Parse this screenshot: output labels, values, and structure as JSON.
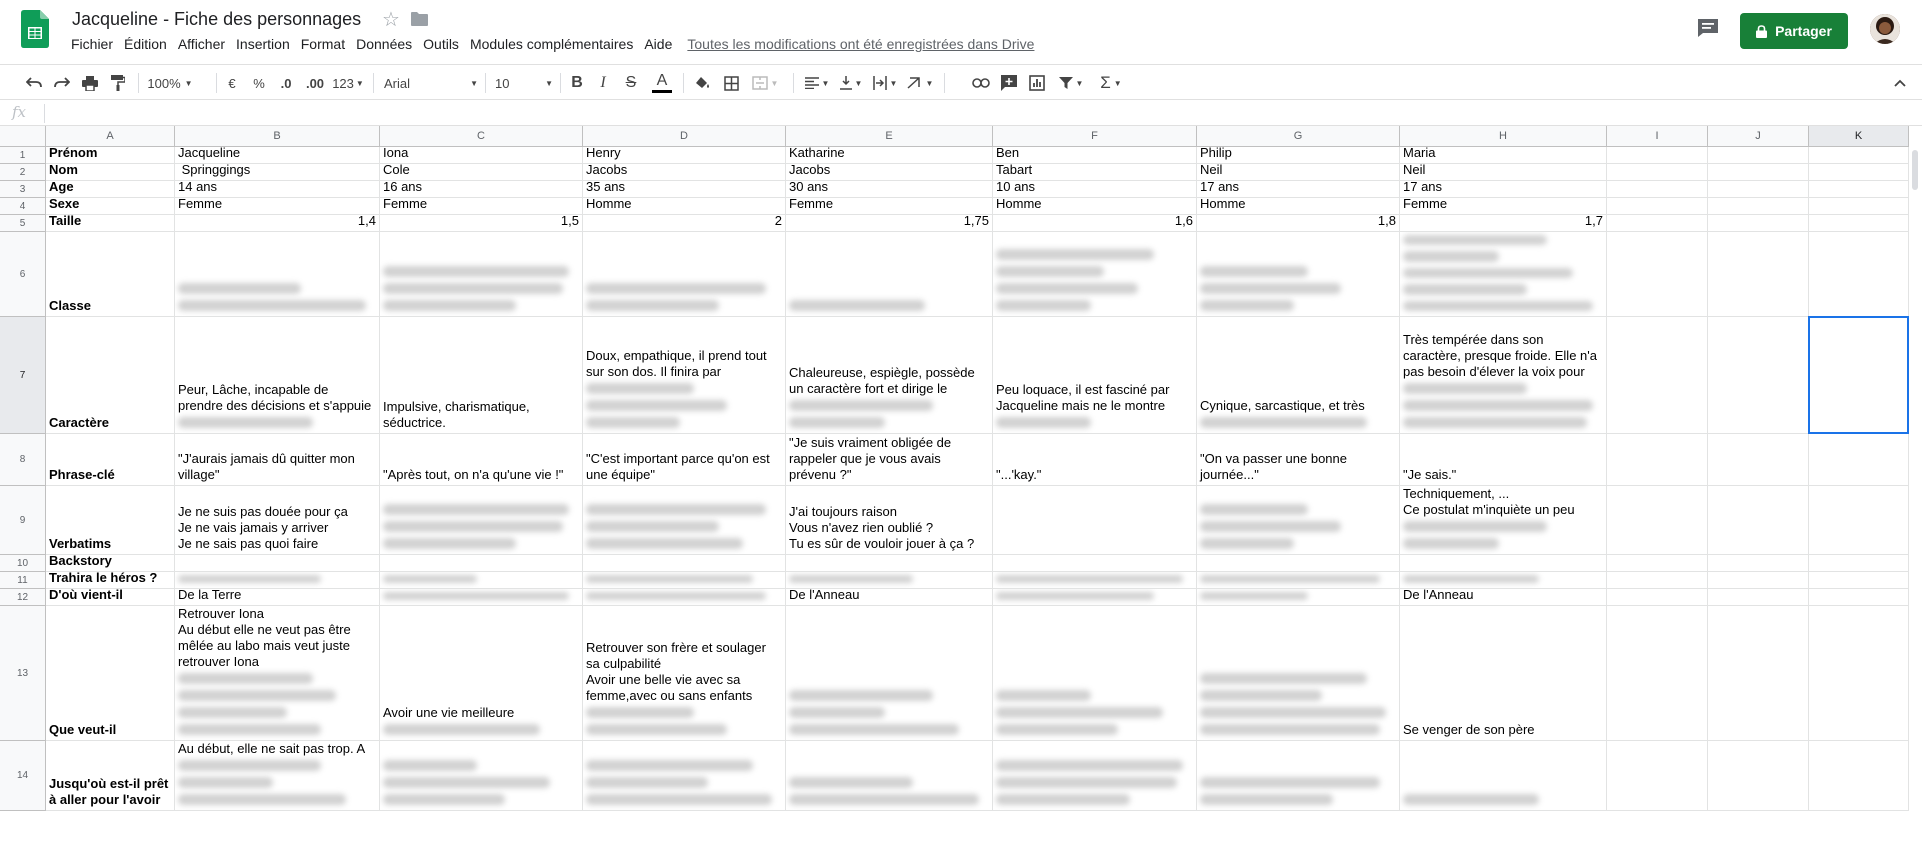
{
  "app": {
    "title": "Jacqueline - Fiche des personnages",
    "saved_status": "Toutes les modifications ont été enregistrées dans Drive",
    "share_label": "Partager",
    "accent_color": "#188038",
    "menu": [
      "Fichier",
      "Édition",
      "Afficher",
      "Insertion",
      "Format",
      "Données",
      "Outils",
      "Modules complémentaires",
      "Aide"
    ]
  },
  "toolbar": {
    "zoom": "100%",
    "currency": "€",
    "percent": "%",
    "dec_less": ".0",
    "dec_more": ".00",
    "format_more": "123",
    "font": "Arial",
    "size": "10",
    "bold": "B",
    "italic": "I",
    "strike": "S",
    "textcolor": "A",
    "icons": [
      "undo-icon",
      "redo-icon",
      "print-icon",
      "paint-format-icon",
      "fill-color-icon",
      "borders-icon",
      "merge-icon",
      "align-left-icon",
      "valign-icon",
      "wrap-icon",
      "rotate-icon",
      "link-icon",
      "comment-icon",
      "chart-icon",
      "filter-icon",
      "functions-icon",
      "collapse-icon"
    ]
  },
  "formula_bar": {
    "fx": "fx",
    "value": ""
  },
  "sheet": {
    "columns": [
      "A",
      "B",
      "C",
      "D",
      "E",
      "F",
      "G",
      "H",
      "I",
      "J",
      "K"
    ],
    "rows": [
      {
        "n": "1",
        "cells": [
          {
            "t": "Prénom",
            "b": 1
          },
          {
            "t": "Jacqueline"
          },
          {
            "t": "Iona"
          },
          {
            "t": "Henry"
          },
          {
            "t": "Katharine"
          },
          {
            "t": "Ben"
          },
          {
            "t": "Philip"
          },
          {
            "t": "Maria"
          }
        ]
      },
      {
        "n": "2",
        "cells": [
          {
            "t": "Nom",
            "b": 1
          },
          {
            "t": " Springgings"
          },
          {
            "t": "Cole"
          },
          {
            "t": "Jacobs"
          },
          {
            "t": "Jacobs"
          },
          {
            "t": "Tabart"
          },
          {
            "t": "Neil"
          },
          {
            "t": "Neil"
          }
        ]
      },
      {
        "n": "3",
        "cells": [
          {
            "t": "Age",
            "b": 1
          },
          {
            "t": "14 ans"
          },
          {
            "t": "16 ans"
          },
          {
            "t": "35 ans"
          },
          {
            "t": "30 ans"
          },
          {
            "t": "10 ans"
          },
          {
            "t": "17 ans"
          },
          {
            "t": "17 ans"
          }
        ]
      },
      {
        "n": "4",
        "cells": [
          {
            "t": "Sexe",
            "b": 1
          },
          {
            "t": "Femme"
          },
          {
            "t": "Femme"
          },
          {
            "t": "Homme"
          },
          {
            "t": "Femme"
          },
          {
            "t": "Homme"
          },
          {
            "t": "Homme"
          },
          {
            "t": "Femme"
          }
        ]
      },
      {
        "n": "5",
        "cells": [
          {
            "t": "Taille",
            "b": 1
          },
          {
            "t": "1,4",
            "n": 1
          },
          {
            "t": "1,5",
            "n": 1
          },
          {
            "t": "2",
            "n": 1
          },
          {
            "t": "1,75",
            "n": 1
          },
          {
            "t": "1,6",
            "n": 1
          },
          {
            "t": "1,8",
            "n": 1
          },
          {
            "t": "1,7",
            "n": 1
          }
        ]
      },
      {
        "n": "6",
        "cells": [
          {
            "t": "Classe",
            "b": 1
          },
          {
            "t": "",
            "z": 2
          },
          {
            "t": "",
            "z": 3
          },
          {
            "t": "",
            "z": 2
          },
          {
            "t": "",
            "z": 1
          },
          {
            "t": "",
            "z": 4
          },
          {
            "t": "",
            "z": 3
          },
          {
            "t": "",
            "z": 5
          }
        ]
      },
      {
        "n": "7",
        "cells": [
          {
            "t": "Caractère",
            "b": 1
          },
          {
            "t": "Peur, Lâche, incapable de\nprendre des décisions et s'appuie",
            "z": 1
          },
          {
            "t": "Impulsive, charismatique,\nséductrice."
          },
          {
            "t": "Doux, empathique, il prend tout\nsur son dos. Il finira par",
            "z": 3
          },
          {
            "t": "Chaleureuse, espiègle, possède\nun caractère fort et dirige le",
            "z": 2
          },
          {
            "t": "Peu loquace, il est fasciné par\nJacqueline mais ne le montre",
            "z": 1
          },
          {
            "t": "Cynique, sarcastique, et très",
            "z": 1
          },
          {
            "t": "Très tempérée dans son\ncaractère, presque froide. Elle n'a\npas besoin d'élever la voix pour",
            "z": 3
          }
        ]
      },
      {
        "n": "8",
        "cells": [
          {
            "t": "Phrase-clé",
            "b": 1
          },
          {
            "t": "\"J'aurais jamais dû quitter mon\nvillage\""
          },
          {
            "t": "\"Après tout, on n'a qu'une vie !\""
          },
          {
            "t": "\"C'est important parce qu'on est\nune équipe\""
          },
          {
            "t": "\"Je suis vraiment obligée de\nrappeler que je vous avais\nprévenu ?\""
          },
          {
            "t": "\"...'kay.\""
          },
          {
            "t": "\"On va passer une bonne\njournée...\""
          },
          {
            "t": "\"Je sais.\""
          }
        ]
      },
      {
        "n": "9",
        "cells": [
          {
            "t": "Verbatims",
            "b": 1
          },
          {
            "t": "Je ne suis pas douée pour ça\nJe ne vais jamais y arriver\nJe ne sais pas quoi faire"
          },
          {
            "t": "",
            "z": 3
          },
          {
            "t": "",
            "z": 3
          },
          {
            "t": "J'ai toujours raison\nVous n'avez rien oublié ?\nTu es sûr de vouloir jouer à ça ?"
          },
          {
            "t": ""
          },
          {
            "t": "",
            "z": 3
          },
          {
            "t": "Techniquement, ...\nCe postulat m'inquiète un peu",
            "z": 2
          }
        ]
      },
      {
        "n": "10",
        "cells": [
          {
            "t": "Backstory",
            "b": 1
          },
          {
            "t": ""
          },
          {
            "t": ""
          },
          {
            "t": ""
          },
          {
            "t": ""
          },
          {
            "t": ""
          },
          {
            "t": ""
          },
          {
            "t": ""
          }
        ]
      },
      {
        "n": "11",
        "cells": [
          {
            "t": "Trahira le héros ?",
            "b": 1
          },
          {
            "t": "",
            "z": 1
          },
          {
            "t": "",
            "z": 1
          },
          {
            "t": "",
            "z": 1
          },
          {
            "t": "",
            "z": 1
          },
          {
            "t": "",
            "z": 1
          },
          {
            "t": "",
            "z": 1
          },
          {
            "t": "",
            "z": 1
          }
        ]
      },
      {
        "n": "12",
        "cells": [
          {
            "t": "D'où vient-il",
            "b": 1
          },
          {
            "t": "De la Terre"
          },
          {
            "t": "",
            "z": 1
          },
          {
            "t": "",
            "z": 1
          },
          {
            "t": "De l'Anneau"
          },
          {
            "t": "",
            "z": 1
          },
          {
            "t": "",
            "z": 1
          },
          {
            "t": "De l'Anneau"
          }
        ]
      },
      {
        "n": "13",
        "cells": [
          {
            "t": "Que veut-il",
            "b": 1
          },
          {
            "t": "Retrouver Iona\nAu début elle ne veut pas être\nmêlée au labo mais veut juste\nretrouver Iona",
            "z": 4
          },
          {
            "t": "Avoir une vie meilleure",
            "z": 1
          },
          {
            "t": "Retrouver son frère et soulager\nsa culpabilité\nAvoir une belle vie avec sa\nfemme,avec ou sans enfants",
            "z": 2
          },
          {
            "t": "",
            "z": 3
          },
          {
            "t": "",
            "z": 3
          },
          {
            "t": "",
            "z": 4
          },
          {
            "t": "Se venger de son père"
          }
        ]
      },
      {
        "n": "14",
        "cells": [
          {
            "t": "Jusqu'où est-il prêt\nà aller pour l'avoir",
            "b": 1
          },
          {
            "t": "Au début, elle ne sait pas trop. A",
            "z": 3
          },
          {
            "t": "",
            "z": 3
          },
          {
            "t": "",
            "z": 3
          },
          {
            "t": "",
            "z": 2
          },
          {
            "t": "",
            "z": 3
          },
          {
            "t": "",
            "z": 2
          },
          {
            "t": "",
            "z": 1
          }
        ]
      }
    ]
  }
}
